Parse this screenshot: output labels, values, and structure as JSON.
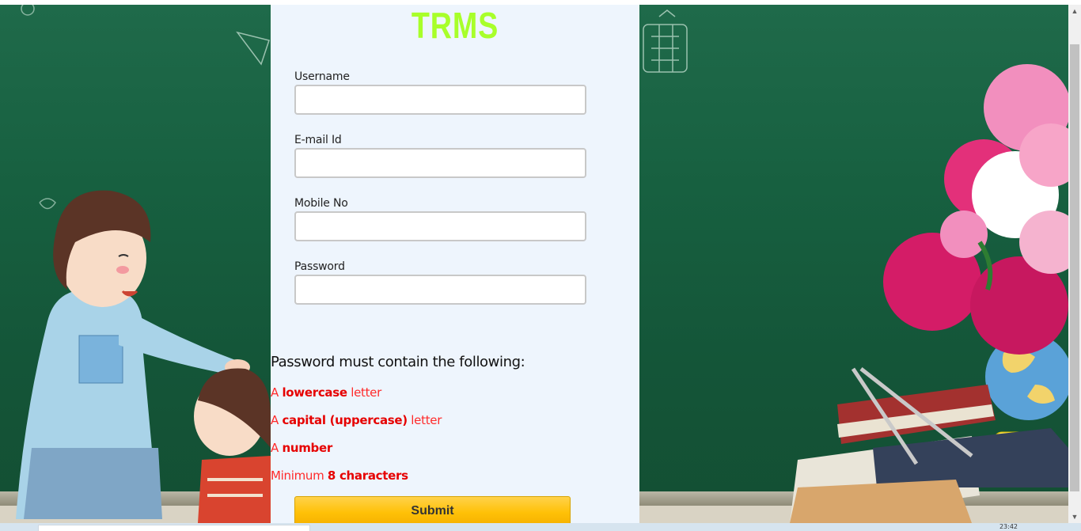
{
  "app": {
    "brand": "TRMS"
  },
  "form": {
    "fields": [
      {
        "label": "Username",
        "value": "",
        "placeholder": ""
      },
      {
        "label": "E-mail Id",
        "value": "",
        "placeholder": ""
      },
      {
        "label": "Mobile No",
        "value": "",
        "placeholder": ""
      },
      {
        "label": "Password",
        "value": "",
        "placeholder": ""
      }
    ],
    "submit_label": "Submit"
  },
  "password_rules": {
    "title": "Password must contain the following:",
    "items": [
      {
        "prefix": "A ",
        "emphasis": "lowercase",
        "suffix": " letter"
      },
      {
        "prefix": "A ",
        "emphasis": "capital (uppercase)",
        "suffix": " letter"
      },
      {
        "prefix": "A ",
        "emphasis": "number",
        "suffix": ""
      },
      {
        "prefix": "Minimum ",
        "emphasis": "8 characters",
        "suffix": ""
      }
    ]
  },
  "taskbar": {
    "time": "23:42"
  },
  "colors": {
    "brand": "#a8ff2a",
    "panel_bg": "#eef5fd",
    "rule_red": "#ff0000",
    "submit": "#ffc107",
    "chalkboard": "#176040"
  },
  "icons": {
    "scroll_up": "scroll-up-arrow-icon",
    "scroll_down": "scroll-down-arrow-icon"
  }
}
